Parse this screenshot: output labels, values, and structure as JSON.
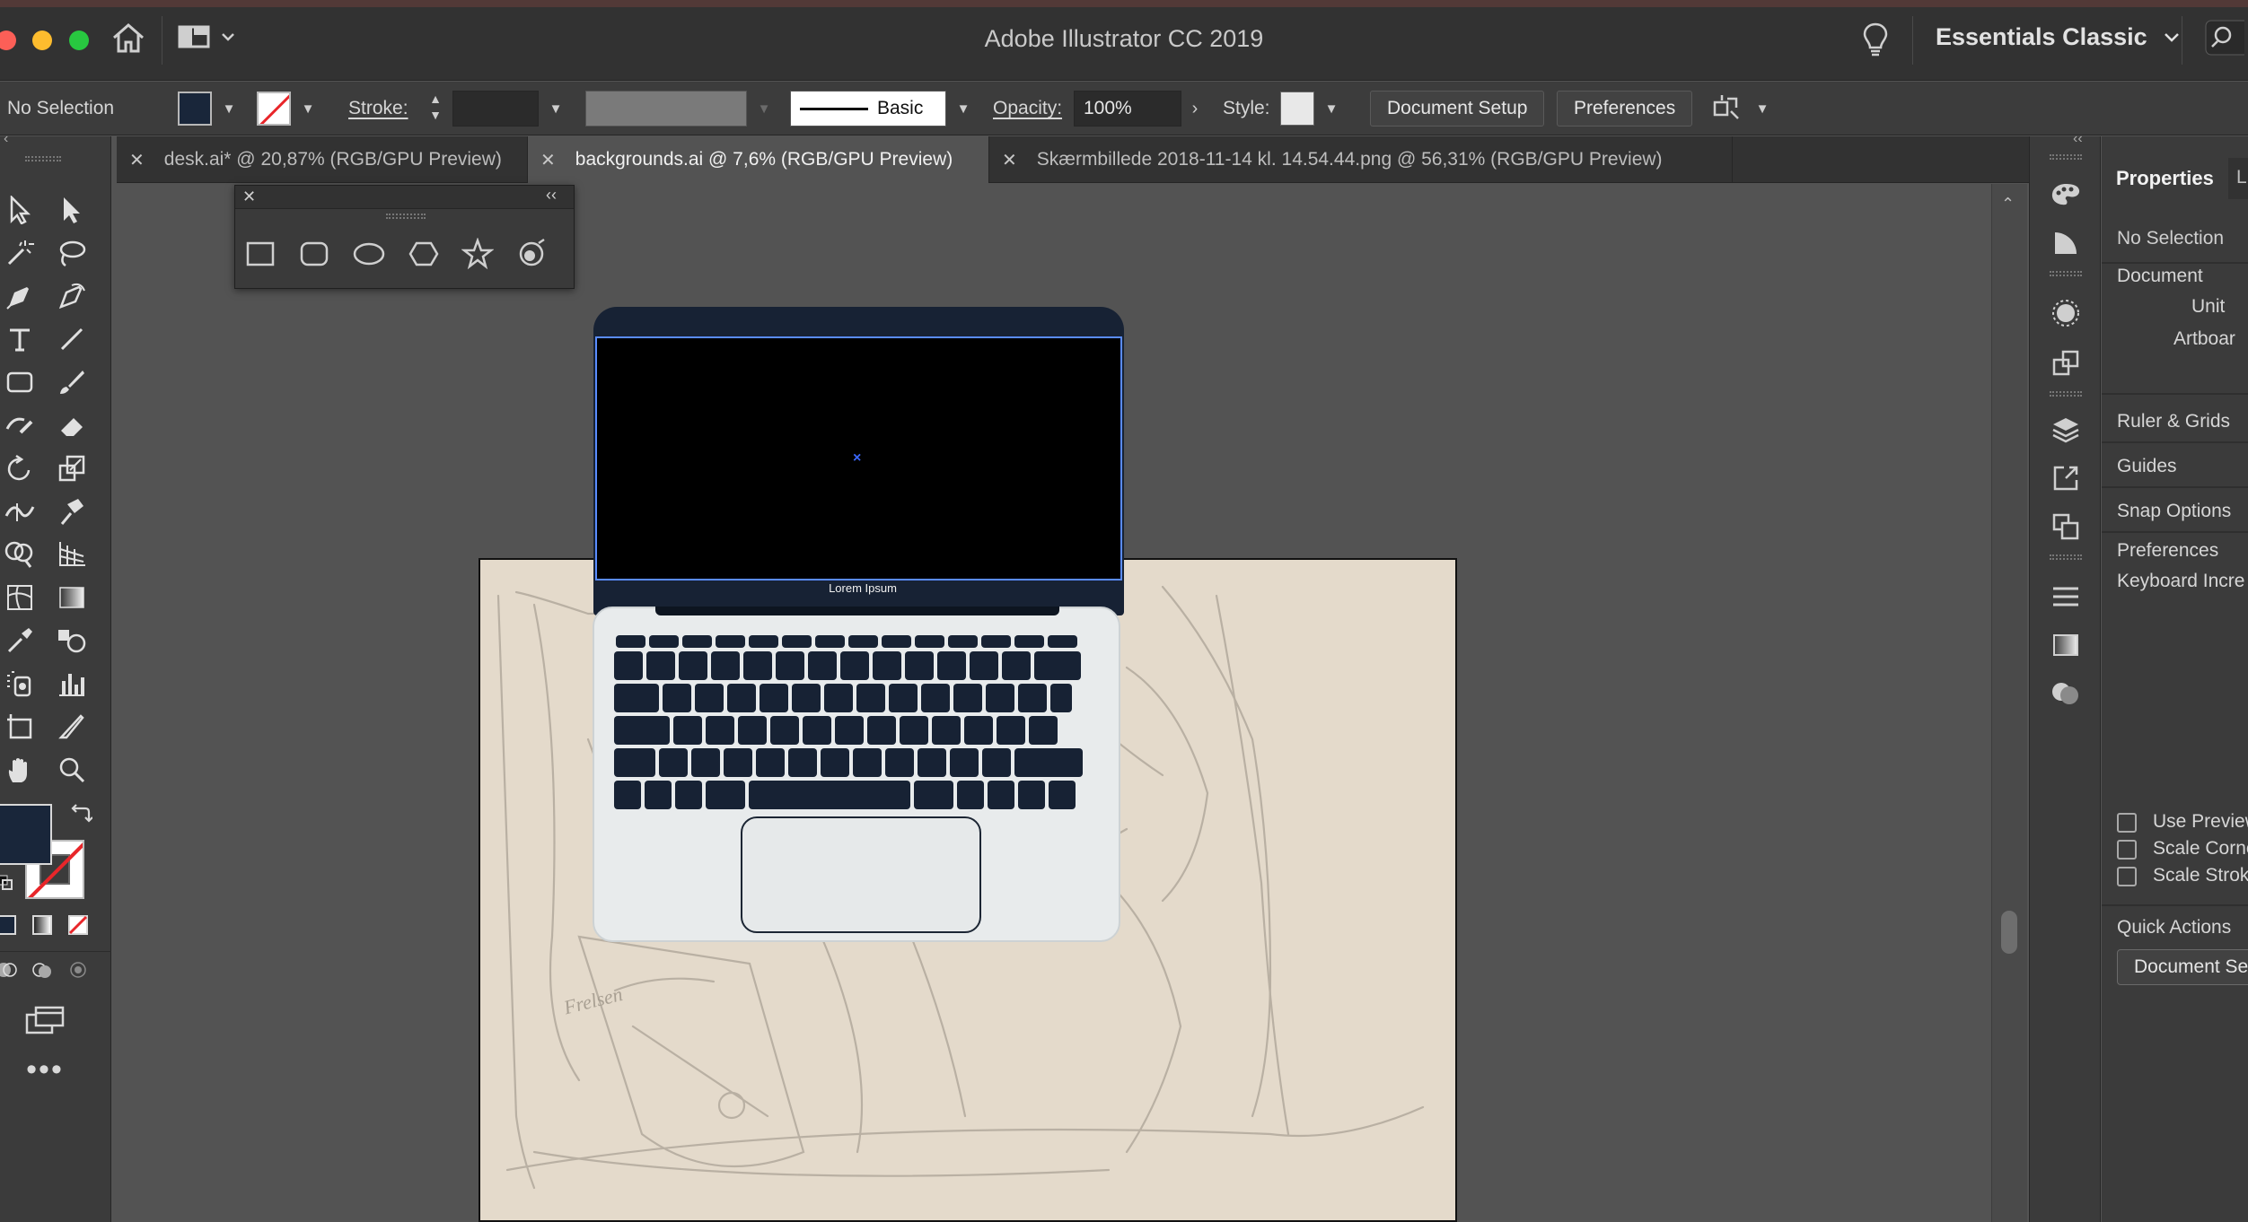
{
  "app": {
    "title": "Adobe Illustrator CC 2019",
    "workspace": "Essentials Classic"
  },
  "control_bar": {
    "selection_status": "No Selection",
    "stroke_label": "Stroke:",
    "brush_style": "Basic",
    "opacity_label": "Opacity:",
    "opacity_value": "100%",
    "style_label": "Style:",
    "document_setup_button": "Document Setup",
    "preferences_button": "Preferences"
  },
  "tabs": [
    {
      "label": "desk.ai* @ 20,87% (RGB/GPU Preview)",
      "active": false
    },
    {
      "label": "backgrounds.ai @ 7,6% (RGB/GPU Preview)",
      "active": true
    },
    {
      "label": "Skærmbillede 2018-11-14 kl. 14.54.44.png @ 56,31% (RGB/GPU Preview)",
      "active": false
    }
  ],
  "canvas": {
    "laptop_screen_label": "Lorem Ipsum",
    "sketch_text": "Frelsen"
  },
  "properties_panel": {
    "tab_properties": "Properties",
    "tab_next_partial": "L",
    "selection_status": "No Selection",
    "section_document": "Document",
    "units_label": "Unit",
    "artboard_label": "Artboar",
    "ruler_grids": "Ruler & Grids",
    "guides": "Guides",
    "snap_options": "Snap Options",
    "preferences": "Preferences",
    "keyboard_increment": "Keyboard Incre",
    "checkboxes": [
      {
        "label": "Use Preview",
        "checked": false
      },
      {
        "label": "Scale Corne",
        "checked": false
      },
      {
        "label": "Scale Stroke",
        "checked": false
      }
    ],
    "quick_actions": "Quick Actions",
    "document_setup_button": "Document Se"
  },
  "colors": {
    "fill": "#19263a",
    "stroke": "none",
    "accent_selection": "#3b68ff"
  },
  "icons": {
    "left_tools": [
      "selection-tool-icon",
      "direct-selection-tool-icon",
      "magic-wand-icon",
      "lasso-icon",
      "pen-tool-icon",
      "curvature-tool-icon",
      "type-tool-icon",
      "line-tool-icon",
      "rectangle-tool-icon",
      "paintbrush-icon",
      "shaper-tool-icon",
      "eraser-icon",
      "rotate-tool-icon",
      "scale-tool-icon",
      "width-tool-icon",
      "puppet-warp-icon",
      "shape-builder-icon",
      "perspective-grid-icon",
      "mesh-tool-icon",
      "gradient-tool-icon",
      "eyedropper-icon",
      "blend-tool-icon",
      "symbol-sprayer-icon",
      "column-graph-icon",
      "artboard-tool-icon",
      "slice-tool-icon",
      "hand-tool-icon",
      "zoom-tool-icon"
    ],
    "shapes": [
      "rectangle-icon",
      "rounded-rectangle-icon",
      "ellipse-icon",
      "polygon-icon",
      "star-icon",
      "flare-icon"
    ]
  }
}
